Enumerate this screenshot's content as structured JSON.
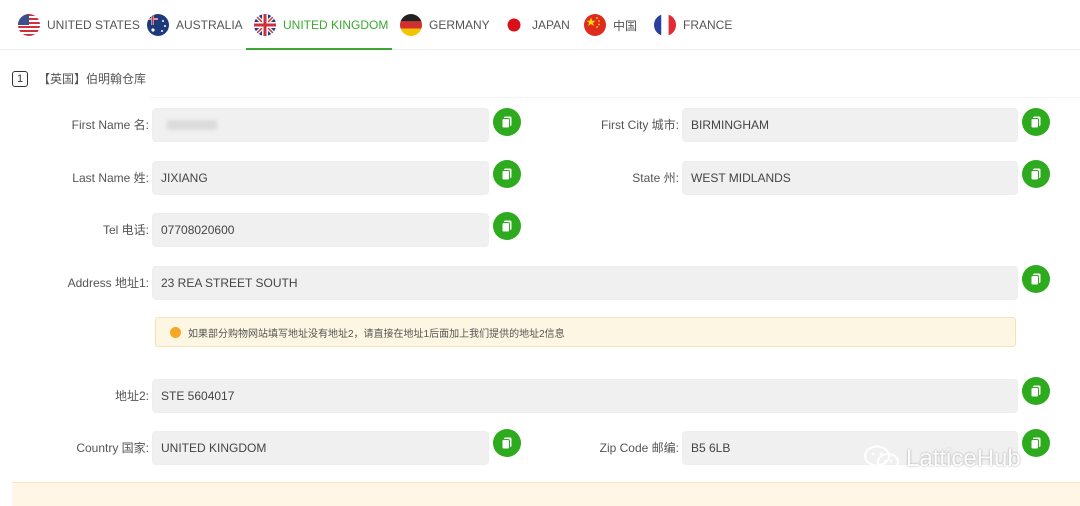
{
  "tabs": [
    {
      "label": "UNITED STATES",
      "flag": "us-flag-icon"
    },
    {
      "label": "AUSTRALIA",
      "flag": "australia-flag-icon"
    },
    {
      "label": "UNITED KINGDOM",
      "flag": "uk-flag-icon",
      "active": true
    },
    {
      "label": "GERMANY",
      "flag": "germany-flag-icon"
    },
    {
      "label": "JAPAN",
      "flag": "japan-flag-icon"
    },
    {
      "label": "中国",
      "flag": "china-flag-icon"
    },
    {
      "label": "FRANCE",
      "flag": "france-flag-icon"
    }
  ],
  "section": {
    "number": "1",
    "title": "【英国】伯明翰仓库"
  },
  "fields": {
    "first_name": {
      "label": "First Name 名:",
      "value": ""
    },
    "first_city": {
      "label": "First City 城市:",
      "value": "BIRMINGHAM"
    },
    "last_name": {
      "label": "Last Name 姓:",
      "value": "JIXIANG"
    },
    "state": {
      "label": "State 州:",
      "value": "WEST MIDLANDS"
    },
    "tel": {
      "label": "Tel 电话:",
      "value": "07708020600"
    },
    "address1": {
      "label": "Address 地址1:",
      "value": "23 REA STREET SOUTH"
    },
    "address2": {
      "label": "地址2:",
      "value": "STE 5604017"
    },
    "country": {
      "label": "Country 国家:",
      "value": "UNITED KINGDOM"
    },
    "zip": {
      "label": "Zip Code 邮编:",
      "value": "B5 6LB"
    }
  },
  "notice": {
    "text": "如果部分购物网站填写地址没有地址2，请直接在地址1后面加上我们提供的地址2信息",
    "icon": "warning-dot-icon"
  },
  "watermark": {
    "text": "LatticeHub",
    "icon": "wechat-icon"
  },
  "colors": {
    "accent": "#3aa832",
    "copy_button": "#2eaa1e",
    "notice_bg": "#fdf6e3",
    "input_bg": "#f0f0f0"
  }
}
